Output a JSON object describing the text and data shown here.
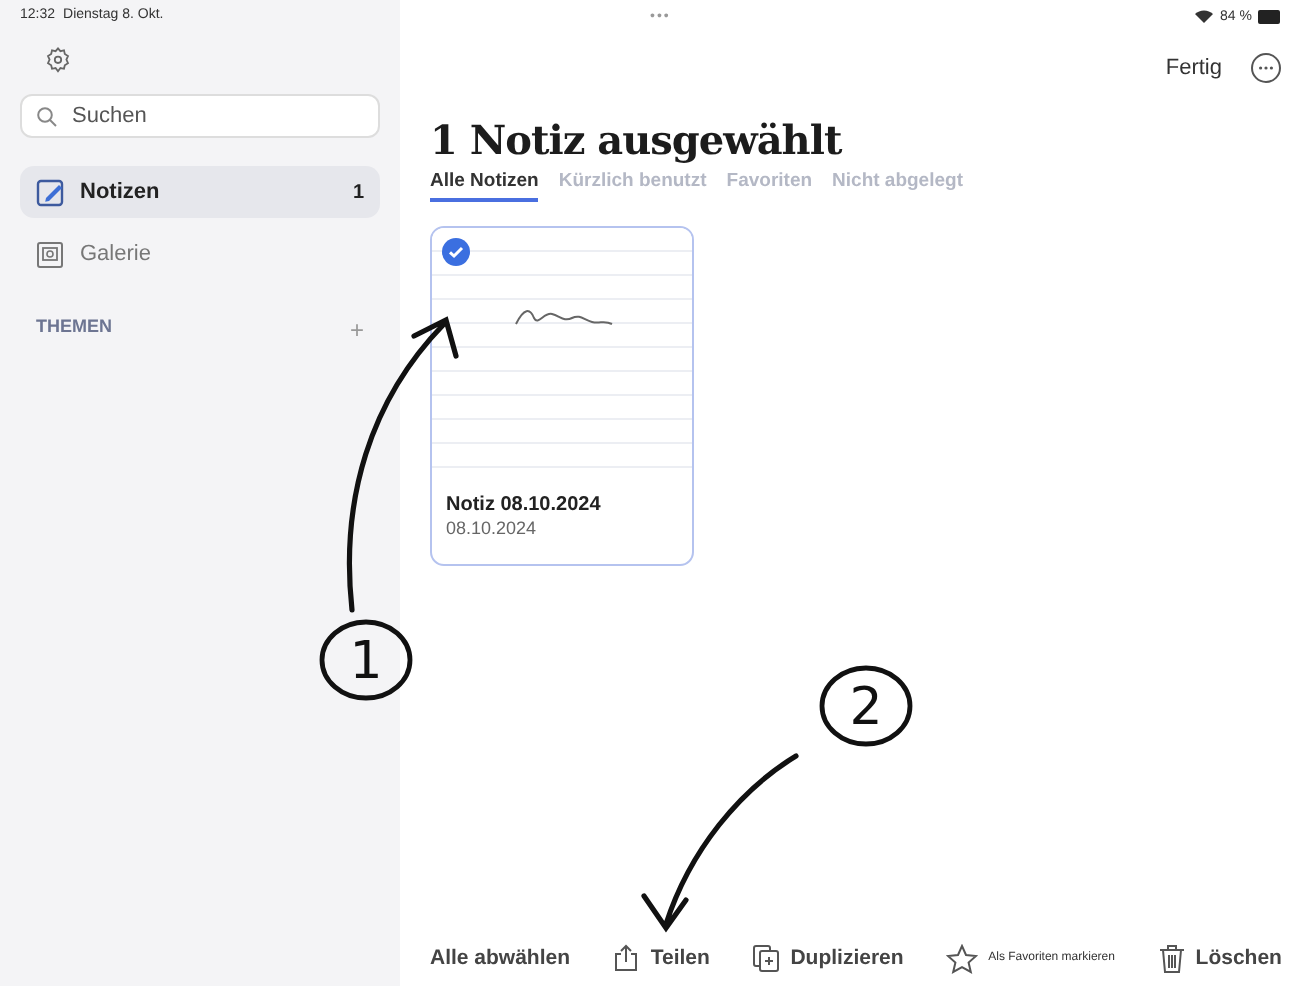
{
  "status_bar": {
    "time": "12:32",
    "date": "Dienstag 8. Okt.",
    "multitask": "•••",
    "battery": "84 %"
  },
  "sidebar": {
    "search": {
      "placeholder": "Suchen"
    },
    "items": [
      {
        "kind": "notes",
        "label": "Notizen",
        "count": "1",
        "selected": true
      },
      {
        "kind": "gallery",
        "label": "Galerie",
        "selected": false
      }
    ],
    "section": {
      "label": "THEMEN",
      "add": "+"
    }
  },
  "header": {
    "done": "Fertig",
    "title": "1 Notiz ausgewählt",
    "tabs": [
      {
        "label": "Alle Notizen",
        "selected": true
      },
      {
        "label": "Kürzlich benutzt",
        "selected": false
      },
      {
        "label": "Favoriten",
        "selected": false
      },
      {
        "label": "Nicht abgelegt",
        "selected": false
      }
    ]
  },
  "notes": [
    {
      "title": "Notiz 08.10.2024",
      "date": "08.10.2024",
      "selected": true
    }
  ],
  "toolbar": [
    {
      "kind": "deselect",
      "label": "Alle abwählen"
    },
    {
      "kind": "share",
      "label": "Teilen"
    },
    {
      "kind": "duplicate",
      "label": "Duplizieren"
    },
    {
      "kind": "favorite",
      "label": "Als Favoriten markieren"
    },
    {
      "kind": "delete",
      "label": "Löschen"
    }
  ],
  "annotations": [
    {
      "label": "1"
    },
    {
      "label": "2"
    }
  ]
}
